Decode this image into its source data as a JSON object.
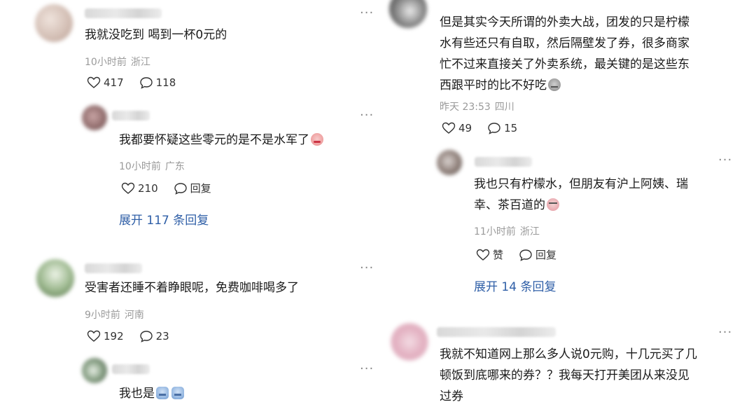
{
  "left": {
    "c1": {
      "text": "我就没吃到 喝到一杯0元的",
      "time": "10小时前",
      "location": "浙江",
      "likes": "417",
      "replies": "118"
    },
    "c1_reply": {
      "text": "我都要怀疑这些零元的是不是水军了",
      "time": "10小时前",
      "location": "广东",
      "likes": "210",
      "reply_label": "回复"
    },
    "c1_expand": "展开 117 条回复",
    "c2": {
      "text": "受害者还睡不着睁眼呢，免费咖啡喝多了",
      "time": "9小时前",
      "location": "河南",
      "likes": "192",
      "replies": "23"
    },
    "c2_reply": {
      "text": "我也是"
    }
  },
  "right": {
    "c1": {
      "lines": [
        "但是其实今天所谓的外卖大战，团发的只是柠檬",
        "水有些还只有自取，然后隔壁发了券，很多商家",
        "忙不过来直接关了外卖系统，最关键的是这些东",
        "西跟平时的比不好吃"
      ],
      "time": "昨天 23:53",
      "location": "四川",
      "likes": "49",
      "replies": "15"
    },
    "c1_reply": {
      "lines": [
        "我也只有柠檬水，但朋友有沪上阿姨、瑞",
        "幸、茶百道的"
      ],
      "time": "11小时前",
      "location": "浙江",
      "like_label": "赞",
      "reply_label": "回复"
    },
    "c1_expand": "展开 14 条回复",
    "c2": {
      "lines": [
        "我就不知道网上那么多人说0元购，十几元买了几",
        "顿饭到底哪来的券？？我每天打开美团从来没见",
        "过券"
      ]
    }
  },
  "more_glyph": "···",
  "colors": {
    "link": "#2f5fa7",
    "meta": "#9a9a9a",
    "text": "#1a1a1a"
  },
  "icons": [
    "heart-icon",
    "comment-icon",
    "more-icon"
  ]
}
